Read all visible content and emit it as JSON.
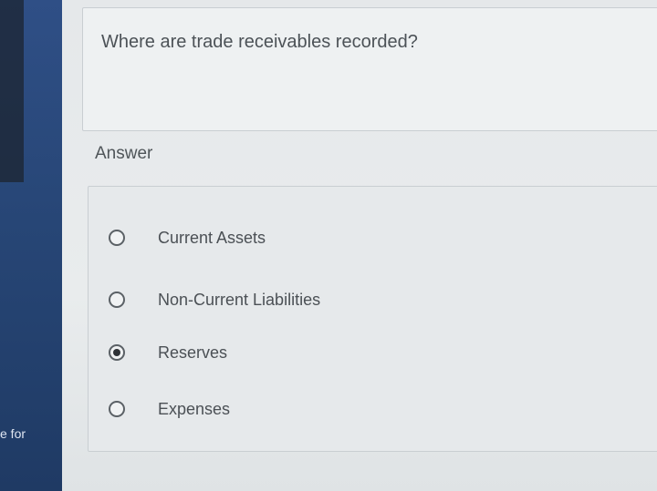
{
  "sidebar": {
    "fragment_text": "e for"
  },
  "question": {
    "text": "Where are trade receivables recorded?"
  },
  "answer": {
    "heading": "Answer",
    "options": [
      {
        "label": "Current Assets",
        "selected": false
      },
      {
        "label": "Non-Current Liabilities",
        "selected": false
      },
      {
        "label": "Reserves",
        "selected": true
      },
      {
        "label": "Expenses",
        "selected": false
      }
    ]
  },
  "colors": {
    "sidebar": "#2f4f86",
    "background": "#e9edf0",
    "text": "#4c5257"
  }
}
